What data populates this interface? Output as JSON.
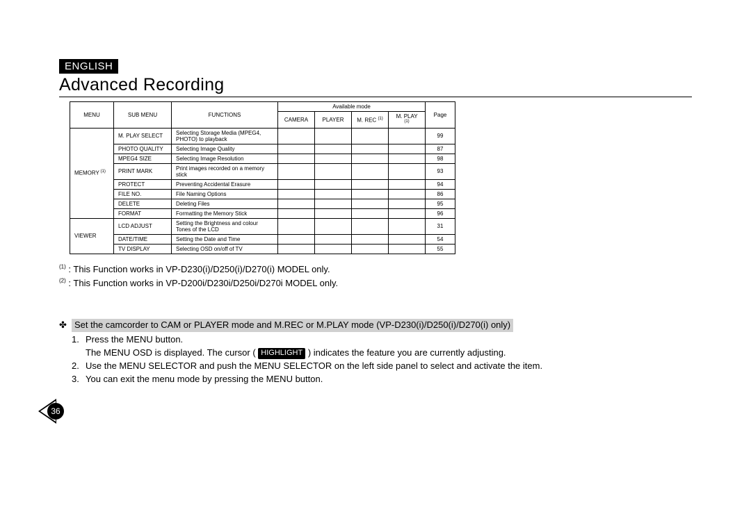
{
  "header": {
    "language": "ENGLISH",
    "title": "Advanced Recording"
  },
  "table": {
    "headers": {
      "menu": "MENU",
      "submenu": "SUB MENU",
      "functions": "FUNCTIONS",
      "available_mode": "Available mode",
      "camera": "CAMERA",
      "player": "PLAYER",
      "mrec": "M. REC",
      "mrec_sup": "(1)",
      "mplay": "M. PLAY",
      "mplay_sup": "(1)",
      "page": "Page"
    },
    "groups": [
      {
        "menu": "MEMORY",
        "menu_sup": "(1)",
        "rows": [
          {
            "sub": "M. PLAY SELECT",
            "func": "Selecting Storage Media (MPEG4, PHOTO) to playback",
            "page": "99"
          },
          {
            "sub": "PHOTO QUALITY",
            "func": "Selecting Image Quality",
            "page": "87"
          },
          {
            "sub": "MPEG4 SIZE",
            "func": "Selecting Image Resolution",
            "page": "98"
          },
          {
            "sub": "PRINT MARK",
            "func": "Print images recorded on a memory stick",
            "page": "93"
          },
          {
            "sub": "PROTECT",
            "func": "Preventing Accidental Erasure",
            "page": "94"
          },
          {
            "sub": "FILE NO.",
            "func": "File Naming Options",
            "page": "86"
          },
          {
            "sub": "DELETE",
            "func": "Deleting Files",
            "page": "95"
          },
          {
            "sub": "FORMAT",
            "func": "Formatting the Memory Stick",
            "page": "96"
          }
        ]
      },
      {
        "menu": "VIEWER",
        "rows": [
          {
            "sub": "LCD ADJUST",
            "func": "Setting the Brightness and colour Tones of the LCD",
            "page": "31"
          },
          {
            "sub": "DATE/TIME",
            "func": "Setting the Date and Time",
            "page": "54"
          },
          {
            "sub": "TV DISPLAY",
            "func": "Selecting OSD on/off of TV",
            "page": "55"
          }
        ]
      }
    ]
  },
  "footnotes": {
    "n1": ": This Function works in VP-D230(i)/D250(i)/D270(i) MODEL only.",
    "n2": ": This Function works in VP-D200i/D230i/D250i/D270i MODEL only."
  },
  "instructions": {
    "bullet_line": "Set the camcorder to CAM or PLAYER mode and M.REC or M.PLAY mode (VP-D230(i)/D250(i)/D270(i) only)",
    "steps": [
      "Press the MENU button.",
      "",
      "Use the MENU SELECTOR and push the MENU SELECTOR on the left side panel to select and activate the item.",
      "You can exit the menu mode by pressing the MENU button."
    ],
    "step1b_pre": "The MENU OSD is displayed. The cursor (",
    "highlight_label": "HIGHLIGHT",
    "step1b_post": ") indicates the feature you are currently adjusting."
  },
  "page_number": "36",
  "chart_data": {
    "type": "table",
    "title": "Advanced Recording – Menu Reference",
    "columns": [
      "MENU",
      "SUB MENU",
      "FUNCTIONS",
      "CAMERA",
      "PLAYER",
      "M. REC (1)",
      "M. PLAY (1)",
      "Page"
    ],
    "rows": [
      [
        "MEMORY (1)",
        "M. PLAY SELECT",
        "Selecting Storage Media (MPEG4, PHOTO) to playback",
        "",
        "",
        "",
        "",
        99
      ],
      [
        "MEMORY (1)",
        "PHOTO QUALITY",
        "Selecting Image Quality",
        "",
        "",
        "",
        "",
        87
      ],
      [
        "MEMORY (1)",
        "MPEG4 SIZE",
        "Selecting Image Resolution",
        "",
        "",
        "",
        "",
        98
      ],
      [
        "MEMORY (1)",
        "PRINT MARK",
        "Print images recorded on a memory stick",
        "",
        "",
        "",
        "",
        93
      ],
      [
        "MEMORY (1)",
        "PROTECT",
        "Preventing Accidental Erasure",
        "",
        "",
        "",
        "",
        94
      ],
      [
        "MEMORY (1)",
        "FILE NO.",
        "File Naming Options",
        "",
        "",
        "",
        "",
        86
      ],
      [
        "MEMORY (1)",
        "DELETE",
        "Deleting Files",
        "",
        "",
        "",
        "",
        95
      ],
      [
        "MEMORY (1)",
        "FORMAT",
        "Formatting the Memory Stick",
        "",
        "",
        "",
        "",
        96
      ],
      [
        "VIEWER",
        "LCD ADJUST",
        "Setting the Brightness and colour Tones of the LCD",
        "",
        "",
        "",
        "",
        31
      ],
      [
        "VIEWER",
        "DATE/TIME",
        "Setting the Date and Time",
        "",
        "",
        "",
        "",
        54
      ],
      [
        "VIEWER",
        "TV DISPLAY",
        "Selecting OSD on/off of TV",
        "",
        "",
        "",
        "",
        55
      ]
    ]
  }
}
